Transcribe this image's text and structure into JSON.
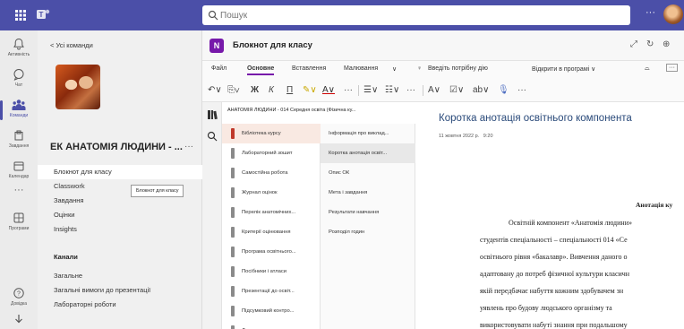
{
  "topbar": {
    "search_placeholder": "Пошук",
    "more": "···"
  },
  "rail": [
    {
      "label": "Активність",
      "icon": "bell-icon"
    },
    {
      "label": "Чат",
      "icon": "chat-icon"
    },
    {
      "label": "Команди",
      "icon": "teams-icon"
    },
    {
      "label": "Завдання",
      "icon": "assignments-icon"
    },
    {
      "label": "Календар",
      "icon": "calendar-icon"
    },
    {
      "label": "···",
      "icon": "more-icon"
    },
    {
      "label": "Програми",
      "icon": "apps-icon"
    },
    {
      "label": "Довідка",
      "icon": "help-icon"
    }
  ],
  "team_panel": {
    "back": "< Усі команди",
    "team_name": "ЕК АНАТОМІЯ ЛЮДИНИ - ...",
    "more": "···",
    "channels": [
      "Блокнот для класу",
      "Classwork",
      "Завдання",
      "Оцінки",
      "Insights"
    ],
    "tooltip": "Блокнот для класу",
    "section_label": "Канали",
    "channel_list": [
      "Загальне",
      "Загальні вимоги до презентації",
      "Лабораторні роботи"
    ]
  },
  "notebook": {
    "title": "Блокнот для класу",
    "ribbon_tabs": [
      "Файл",
      "Основне",
      "Вставлення",
      "Малювання"
    ],
    "tell_me": "Введіть потрібну дію",
    "open_in_app": "Відкрити в програмі ∨",
    "breadcrumb": "АНАТОМІЯ ЛЮДИНИ - 014 Середня освіта (Фізична ку...",
    "sections": [
      "Бібліотека курсу",
      "Лабораторний зошит",
      "Самостійна робота",
      "Журнал оцінок",
      "Перелік анатомічних...",
      "Критерії оцінювання",
      "Програма освітнього...",
      "Посібники і атласи",
      "Презентації до освіт...",
      "Підсумковий контро...",
      "Ласкаво просимо"
    ],
    "section_colors": [
      "#c0392b",
      "#8a8a8a",
      "#8a8a8a",
      "#8a8a8a",
      "#8a8a8a",
      "#8a8a8a",
      "#8a8a8a",
      "#8a8a8a",
      "#8a8a8a",
      "#8a8a8a",
      "#8a8a8a"
    ],
    "pages": [
      "Інформація про виклад...",
      "Коротка анотація освіт...",
      "Опис ОК",
      "Мета і завдання",
      "Результати навчання",
      "Розподіл годин"
    ]
  },
  "page": {
    "title": "Коротка анотація освітнього компонента",
    "date": "11 жовтня 2022 р.",
    "time": "9:20",
    "heading": "Анотація ку",
    "lines": [
      "Освітній компонент «Анатомія людини»",
      "студентів спеціальності – спеціальності 014 «Се",
      "освітнього рівня «бакалавр». Вивчення даного о",
      "адаптовану до потреб фізичної культури класичн",
      "якій передбачає набуття кожним здобувачем зн",
      "уявлень про будову людського організму та",
      "використовувати набуті знання при подальшому"
    ]
  }
}
